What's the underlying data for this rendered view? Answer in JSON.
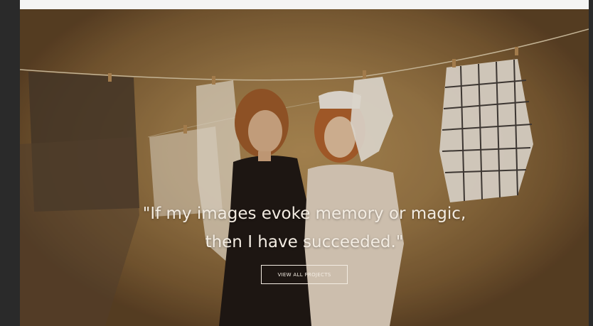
{
  "hero": {
    "quote": "\"If my images evoke memory or magic, then I have succeeded.\"",
    "cta_label": "VIEW ALL PROJECTS"
  },
  "colors": {
    "background_dark": "#2b2b2b",
    "top_bar": "#f4f4f4",
    "hero_warm": "#9c7a48",
    "text_light": "#f3ece2"
  }
}
